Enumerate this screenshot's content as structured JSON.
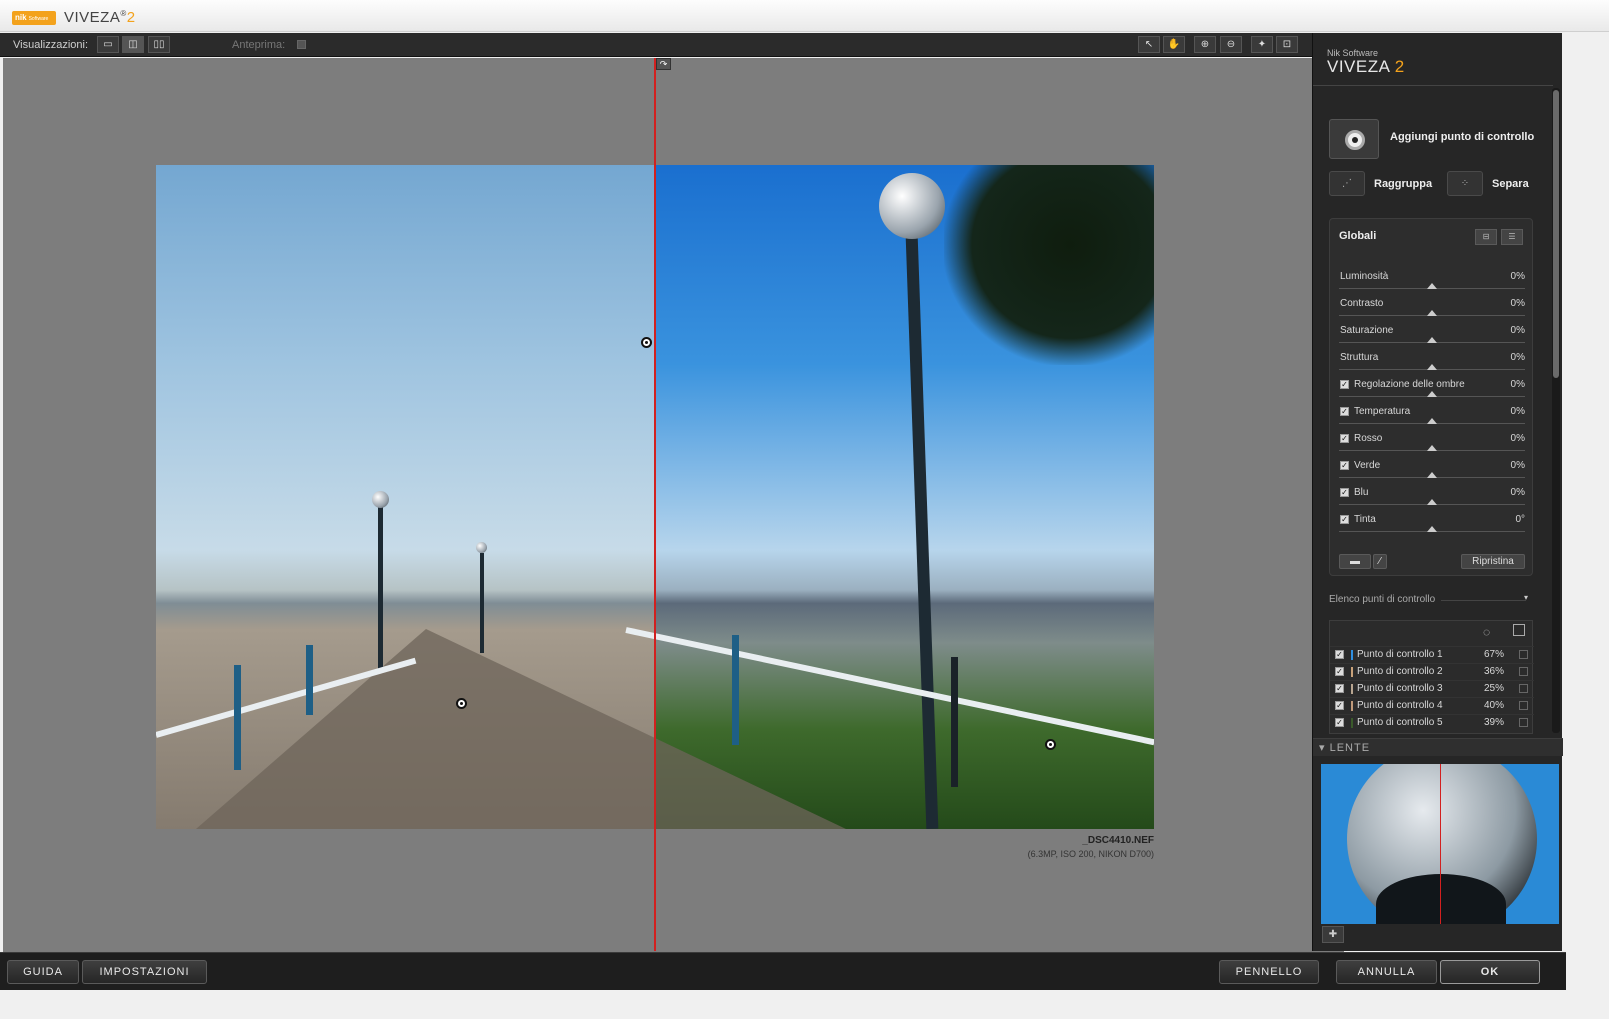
{
  "window": {
    "logo_text": "nik",
    "logo_sub": "Software",
    "title_main": "VIVEZA",
    "title_reg": "®",
    "title_version": "2"
  },
  "toolbar": {
    "views_label": "Visualizzazioni:",
    "preview_label": "Anteprima:",
    "view_buttons": [
      "single-view-icon",
      "split-view-icon",
      "side-by-side-view-icon"
    ],
    "tools": [
      "arrow-tool-icon",
      "hand-tool-icon",
      "zoom-in-icon",
      "zoom-out-icon",
      "loupe-tool-icon",
      "fit-screen-icon"
    ]
  },
  "image": {
    "filename": "_DSC4410.NEF",
    "info": "(6.3MP, ISO 200, NIKON D700)"
  },
  "panel": {
    "brand_sub": "Nik Software",
    "brand_name": "VIVEZA",
    "brand_version": "2",
    "add_control_point": "Aggiungi punto di controllo",
    "group": "Raggruppa",
    "ungroup": "Separa",
    "globals": {
      "title": "Globali",
      "sliders": [
        {
          "label": "Luminosità",
          "value": "0%",
          "checkbox": false
        },
        {
          "label": "Contrasto",
          "value": "0%",
          "checkbox": false
        },
        {
          "label": "Saturazione",
          "value": "0%",
          "checkbox": false
        },
        {
          "label": "Struttura",
          "value": "0%",
          "checkbox": false
        },
        {
          "label": "Regolazione delle ombre",
          "value": "0%",
          "checkbox": true
        },
        {
          "label": "Temperatura",
          "value": "0%",
          "checkbox": true
        },
        {
          "label": "Rosso",
          "value": "0%",
          "checkbox": true
        },
        {
          "label": "Verde",
          "value": "0%",
          "checkbox": true
        },
        {
          "label": "Blu",
          "value": "0%",
          "checkbox": true
        },
        {
          "label": "Tinta",
          "value": "0°",
          "checkbox": true
        }
      ],
      "reset": "Ripristina"
    },
    "control_points_header": "Elenco punti di controllo",
    "control_points": [
      {
        "name": "Punto di controllo 1",
        "value": "67%",
        "color": "#2f8fe0"
      },
      {
        "name": "Punto di controllo 2",
        "value": "36%",
        "color": "#c9a27a"
      },
      {
        "name": "Punto di controllo 3",
        "value": "25%",
        "color": "#b8a590"
      },
      {
        "name": "Punto di controllo 4",
        "value": "40%",
        "color": "#c09a7a"
      },
      {
        "name": "Punto di controllo 5",
        "value": "39%",
        "color": "#3a5a2a"
      }
    ],
    "loupe_title": "LENTE"
  },
  "footer": {
    "help": "GUIDA",
    "settings": "IMPOSTAZIONI",
    "brush": "PENNELLO",
    "cancel": "ANNULLA",
    "ok": "OK"
  },
  "colors": {
    "accent": "#f3a21c",
    "split_line": "#d2201f"
  }
}
